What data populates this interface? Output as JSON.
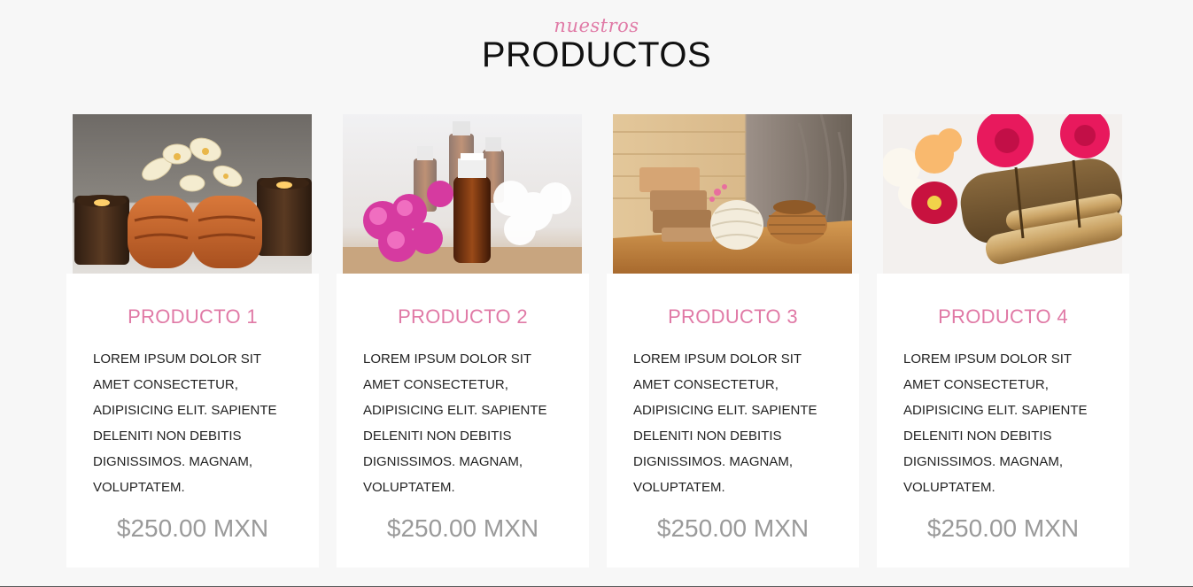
{
  "section": {
    "kicker": "nuestros",
    "title": "PRODUCTOS"
  },
  "colors": {
    "accent": "#e07aa6",
    "price": "#9a9a9a",
    "background": "#f7f7f7",
    "card": "#ffffff"
  },
  "products": [
    {
      "image_icon": "spa-towels-candles-orchids-image",
      "title": "PRODUCTO 1",
      "description": "LOREM IPSUM DOLOR SIT AMET CONSECTETUR, ADIPISICING ELIT. SAPIENTE DELENITI NON DEBITIS DIGNISSIMOS. MAGNAM, VOLUPTATEM.",
      "price": "$250.00 MXN"
    },
    {
      "image_icon": "essential-oils-flowers-image",
      "title": "PRODUCTO 2",
      "description": "LOREM IPSUM DOLOR SIT AMET CONSECTETUR, ADIPISICING ELIT. SAPIENTE DELENITI NON DEBITIS DIGNISSIMOS. MAGNAM, VOLUPTATEM.",
      "price": "$250.00 MXN"
    },
    {
      "image_icon": "soap-bars-towel-basket-image",
      "title": "PRODUCTO 3",
      "description": "LOREM IPSUM DOLOR SIT AMET CONSECTETUR, ADIPISICING ELIT. SAPIENTE DELENITI NON DEBITIS DIGNISSIMOS. MAGNAM, VOLUPTATEM.",
      "price": "$250.00 MXN"
    },
    {
      "image_icon": "roses-bamboo-image",
      "title": "PRODUCTO 4",
      "description": "LOREM IPSUM DOLOR SIT AMET CONSECTETUR, ADIPISICING ELIT. SAPIENTE DELENITI NON DEBITIS DIGNISSIMOS. MAGNAM, VOLUPTATEM.",
      "price": "$250.00 MXN"
    }
  ]
}
